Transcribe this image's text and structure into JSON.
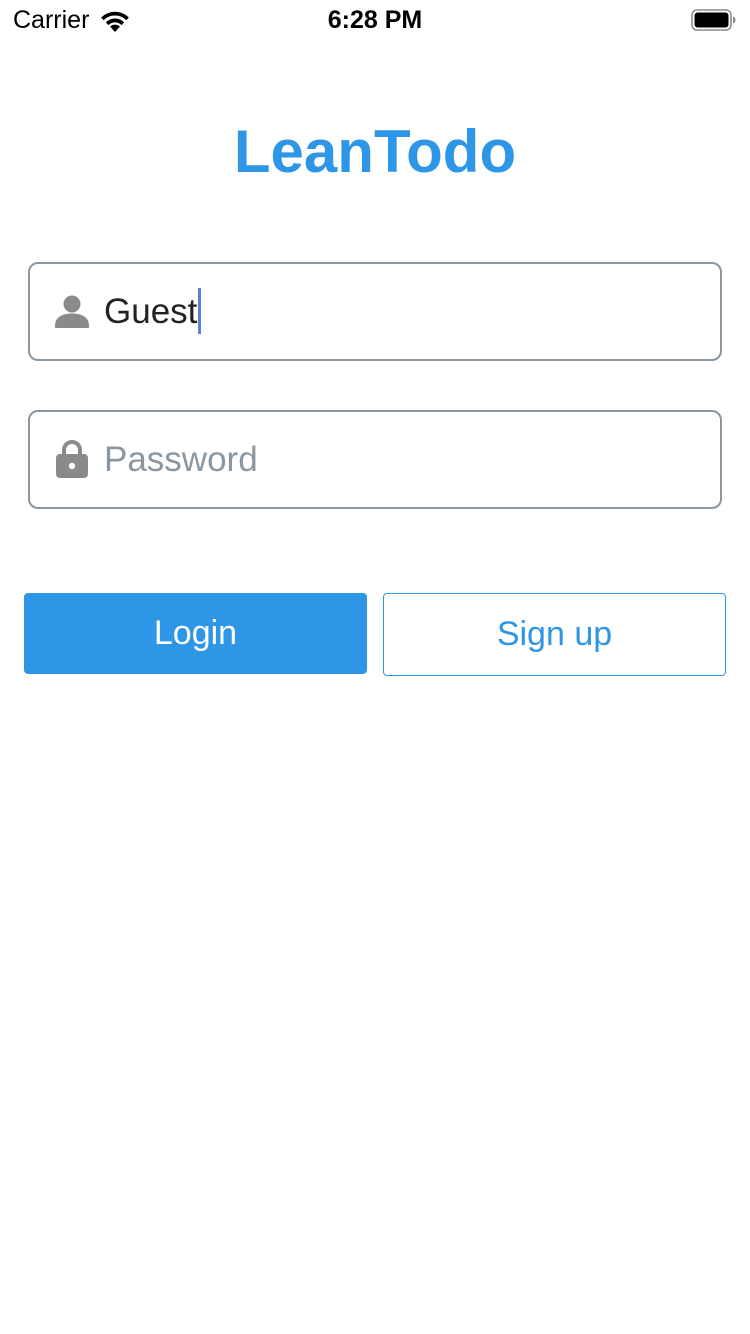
{
  "status_bar": {
    "carrier": "Carrier",
    "time": "6:28 PM",
    "wifi_icon": "wifi-icon",
    "battery_icon": "battery-full-icon"
  },
  "app": {
    "title": "LeanTodo",
    "brand_color": "#2d96e6"
  },
  "login_form": {
    "username": {
      "icon": "person-icon",
      "value": "Guest",
      "has_focus": true
    },
    "password": {
      "icon": "lock-icon",
      "value": "",
      "placeholder": "Password"
    },
    "login_label": "Login",
    "signup_label": "Sign up"
  }
}
